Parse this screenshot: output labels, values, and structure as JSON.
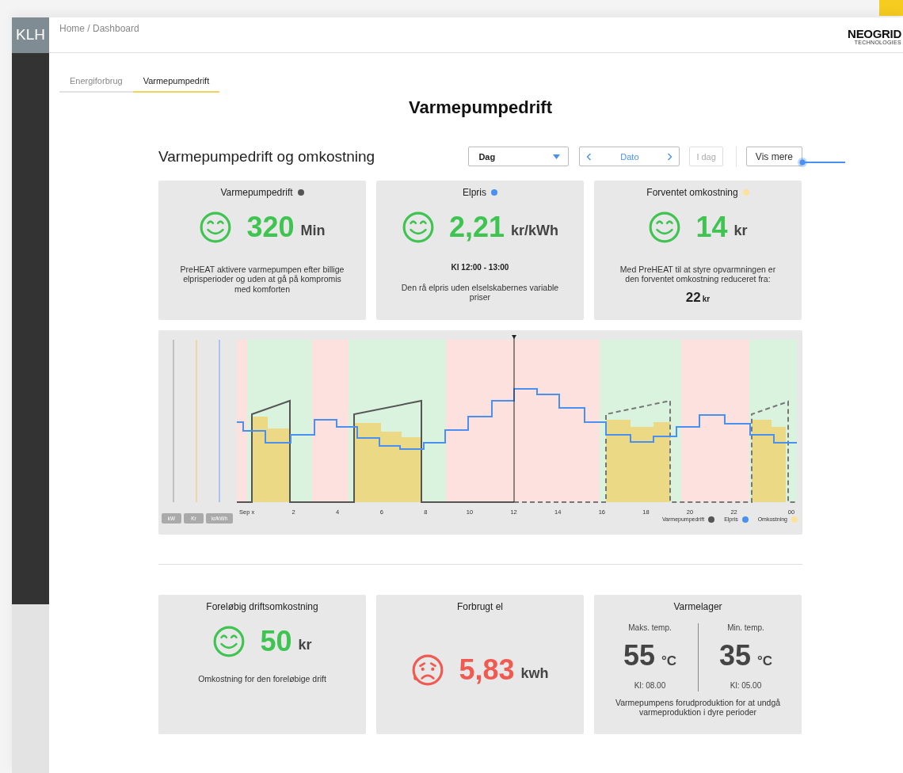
{
  "sidebar": {
    "logo": "KLH"
  },
  "breadcrumb": "Home / Dashboard",
  "brand": {
    "name": "NEOGRID",
    "tagline": "TECHNOLOGIES"
  },
  "tabs": [
    {
      "label": "Energiforbrug",
      "selected": false
    },
    {
      "label": "Varmepumpedrift",
      "selected": true
    }
  ],
  "page_title": "Varmepumpedrift",
  "section": {
    "title": "Varmepumpedrift og omkostning",
    "period": "Dag",
    "date_label": "Dato",
    "today_button": {
      "label": "I dag",
      "disabled": true
    },
    "more_button": "Vis mere"
  },
  "top_cards": [
    {
      "title": "Varmepumpedrift",
      "color": "#555555",
      "face": {
        "kind": "smile"
      },
      "value": "320",
      "unit": "Min",
      "note": "PreHEAT aktivere varmepumpen efter billige elprisperioder og uden at gå på kompromis med komforten"
    },
    {
      "title": "Elpris",
      "color": "#4a90f0",
      "face": {
        "kind": "smile"
      },
      "value": "2,21",
      "unit": "kr/kWh",
      "subtitle": "Kl 12:00 - 13:00",
      "note": "Den rå elpris uden elselskabernes variable priser"
    },
    {
      "title": "Forventet omkostning",
      "color": "#fce29a",
      "face": {
        "kind": "smile"
      },
      "value": "14",
      "unit": "kr",
      "note": "Med PreHEAT til at styre opvarmningen er den forventet omkostning reduceret fra:",
      "footer_value": "22",
      "footer_unit": "kr"
    }
  ],
  "chart": {
    "unit_buttons": [
      "kW",
      "Kr",
      "kr/kWh"
    ],
    "x_labels": [
      "Sep x",
      "2",
      "4",
      "6",
      "8",
      "10",
      "12",
      "14",
      "16",
      "18",
      "20",
      "22",
      "00"
    ],
    "legend": [
      {
        "label": "Varmepumpedrift",
        "color": "#555555"
      },
      {
        "label": "Elpris",
        "color": "#4a90f0"
      },
      {
        "label": "Omkostning",
        "color": "#fce29a"
      }
    ]
  },
  "bottom_cards": [
    {
      "kind": "metric",
      "title": "Foreløbig driftsomkostning",
      "face": {
        "kind": "smile"
      },
      "value": "50",
      "unit": "kr",
      "note": "Omkostning for den foreløbige drift"
    },
    {
      "kind": "metric",
      "title": "Forbrugt el",
      "face": {
        "kind": "sad"
      },
      "value": "5,83",
      "unit": "kwh"
    },
    {
      "kind": "storage",
      "title": "Varmelager",
      "columns": [
        {
          "label": "Maks. temp.",
          "value": "55",
          "unit": "°C",
          "time": "Kl: 08.00"
        },
        {
          "label": "Min. temp.",
          "value": "35",
          "unit": "°C",
          "time": "Kl: 05.00"
        }
      ],
      "note": "Varmepumpens forudproduktion for at undgå varmeproduktion i dyre perioder"
    }
  ]
}
